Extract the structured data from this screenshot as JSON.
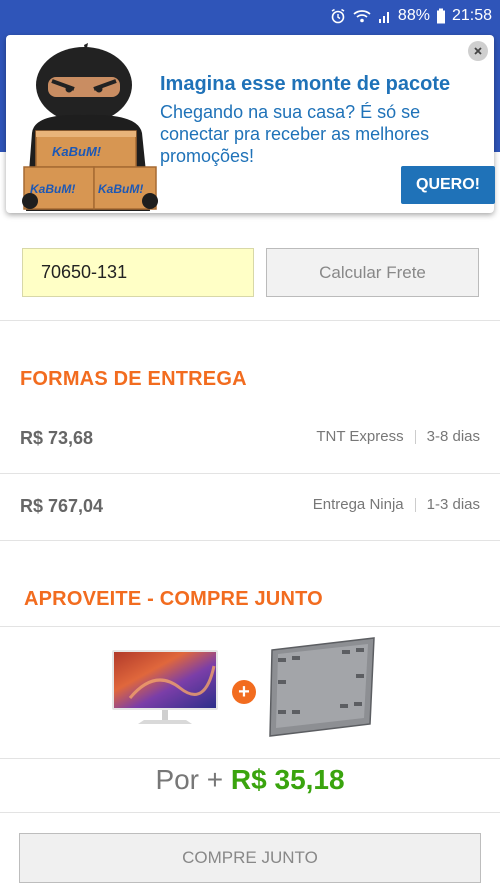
{
  "status_bar": {
    "battery": "88%",
    "time": "21:58",
    "icons": [
      "alarm-icon",
      "wifi-icon",
      "signal-icon",
      "battery-icon"
    ],
    "background": "#2f55b9"
  },
  "promo": {
    "title": "Imagina esse monte de pacote",
    "text": "Chegando na sua casa? É só se conectar pra receber as melhores promoções!",
    "cta_label": "QUERO!",
    "box_label": "KaBuM!",
    "accent": "#1f72b8"
  },
  "cep": {
    "value": "70650-131",
    "button_label": "Calcular Frete"
  },
  "delivery": {
    "title": "FORMAS DE ENTREGA",
    "options": [
      {
        "price": "R$ 73,68",
        "carrier": "TNT Express",
        "time": "3-8 dias"
      },
      {
        "price": "R$ 767,04",
        "carrier": "Entrega Ninja",
        "time": "1-3 dias"
      }
    ]
  },
  "bundle": {
    "title": "APROVEITE - COMPRE JUNTO",
    "price_prefix": "Por +",
    "price_value": "R$ 35,18",
    "button_label": "COMPRE JUNTO"
  },
  "colors": {
    "orange": "#f26c1f",
    "green": "#3aa40e"
  }
}
